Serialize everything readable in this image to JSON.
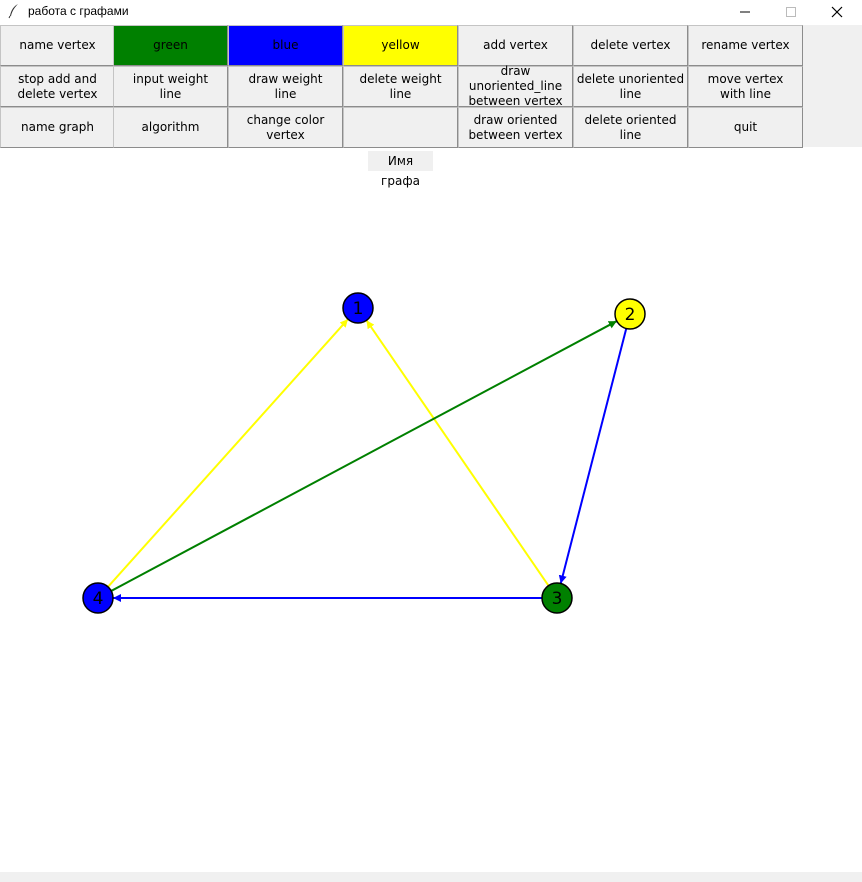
{
  "window": {
    "title": "работа с графами"
  },
  "toolbar": {
    "rows": [
      [
        {
          "name": "name-vertex-button",
          "label": "name vertex",
          "color": "default"
        },
        {
          "name": "green-button",
          "label": "green",
          "color": "green"
        },
        {
          "name": "blue-button",
          "label": "blue",
          "color": "blue"
        },
        {
          "name": "yellow-button",
          "label": "yellow",
          "color": "yellow"
        },
        {
          "name": "add-vertex-button",
          "label": "add vertex",
          "color": "default"
        },
        {
          "name": "delete-vertex-button",
          "label": "delete vertex",
          "color": "default"
        },
        {
          "name": "rename-vertex-button",
          "label": "rename vertex",
          "color": "default"
        }
      ],
      [
        {
          "name": "stop-add-delete-vertex-button",
          "label": "stop add and\ndelete vertex",
          "color": "default"
        },
        {
          "name": "input-weight-line-button",
          "label": "input weight\nline",
          "color": "default"
        },
        {
          "name": "draw-weight-line-button",
          "label": "draw weight\nline",
          "color": "default"
        },
        {
          "name": "delete-weight-line-button",
          "label": "delete weight\nline",
          "color": "default"
        },
        {
          "name": "draw-unoriented-line-button",
          "label": "draw unoriented_line\nbetween vertex",
          "color": "default"
        },
        {
          "name": "delete-unoriented-line-button",
          "label": "delete unoriented\nline",
          "color": "default"
        },
        {
          "name": "move-vertex-with-line-button",
          "label": "move vertex\nwith line",
          "color": "default"
        }
      ],
      [
        {
          "name": "name-graph-button",
          "label": "name graph",
          "color": "default"
        },
        {
          "name": "algorithm-button",
          "label": "algorithm",
          "color": "default"
        },
        {
          "name": "change-color-vertex-button",
          "label": "change color\nvertex",
          "color": "default"
        },
        {
          "name": "empty-button",
          "label": "",
          "color": "default"
        },
        {
          "name": "draw-oriented-line-button",
          "label": "draw oriented\nbetween vertex",
          "color": "default"
        },
        {
          "name": "delete-oriented-line-button",
          "label": "delete oriented\nline",
          "color": "default"
        },
        {
          "name": "quit-button",
          "label": "quit",
          "color": "default"
        }
      ]
    ]
  },
  "graph_name_label": "Имя графа",
  "colors": {
    "green": "#008000",
    "blue": "#0000ff",
    "yellow": "#ffff00"
  },
  "graph": {
    "vertices": [
      {
        "id": "1",
        "label": "1",
        "color": "blue"
      },
      {
        "id": "2",
        "label": "2",
        "color": "yellow"
      },
      {
        "id": "3",
        "label": "3",
        "color": "green"
      },
      {
        "id": "4",
        "label": "4",
        "color": "blue"
      }
    ],
    "edges": [
      {
        "from": "4",
        "to": "1",
        "color": "yellow",
        "directed": true
      },
      {
        "from": "3",
        "to": "1",
        "color": "yellow",
        "directed": true
      },
      {
        "from": "4",
        "to": "2",
        "color": "green",
        "directed": true
      },
      {
        "from": "2",
        "to": "3",
        "color": "blue",
        "directed": true
      },
      {
        "from": "3",
        "to": "4",
        "color": "blue",
        "directed": true
      }
    ]
  }
}
